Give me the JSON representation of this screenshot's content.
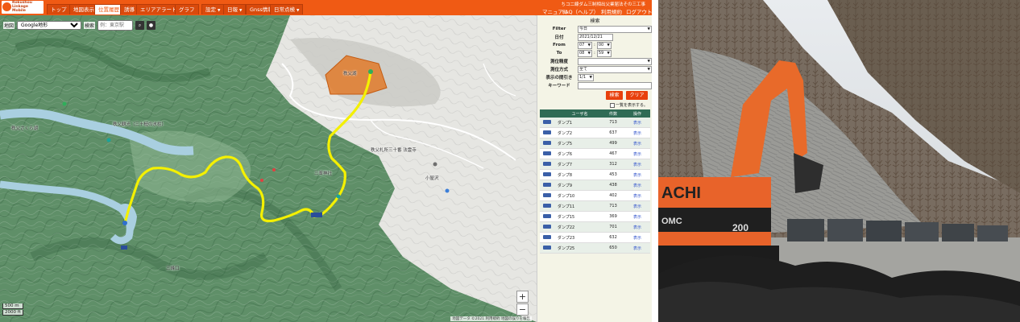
{
  "header": {
    "logo_lines": [
      "Rokushou",
      "Linkage",
      "Mobile"
    ],
    "site_title": "ちコ二線ダム三制相出父業届法その三工事",
    "nav": [
      {
        "label": "トップ",
        "active": false,
        "dropdown": false
      },
      {
        "label": "地図表示",
        "active": false,
        "dropdown": false
      },
      {
        "label": "位置履歴",
        "active": true,
        "dropdown": false
      },
      {
        "label": "誘導",
        "active": false,
        "dropdown": false
      },
      {
        "label": "エリアアラート",
        "active": false,
        "dropdown": false
      },
      {
        "label": "グラフ",
        "active": false,
        "dropdown": false
      },
      {
        "label": "設定",
        "active": false,
        "dropdown": true
      },
      {
        "label": "日報",
        "active": false,
        "dropdown": true
      },
      {
        "label": "Gnss情報",
        "active": false,
        "dropdown": false
      },
      {
        "label": "日常点検",
        "active": false,
        "dropdown": true
      }
    ],
    "right_links": [
      "マニュアル",
      "FAQ（ヘルプ）",
      "利用規約",
      "ログアウト"
    ]
  },
  "map": {
    "map_type_label": "地図",
    "map_type_value": "Google地形",
    "search_label": "検索",
    "search_placeholder": "例：東京駅",
    "zoom_in": "+",
    "zoom_out": "−",
    "scale": [
      "500 m",
      "2000 ft"
    ],
    "attribution": "地図データ ©2021  利用規約  地図の誤りを報告",
    "place_labels": [
      {
        "text": "秩父湖"
      },
      {
        "text": "秩父さくら湖"
      },
      {
        "text": "秩父観光（三十槌の氷柱）"
      },
      {
        "text": "秩父札所三十番 法雲寺"
      },
      {
        "text": "小屋沢"
      },
      {
        "text": "三峯神社"
      },
      {
        "text": "三峰口"
      }
    ]
  },
  "panel": {
    "title": "検索",
    "filter_label": "Filter",
    "filter_value": "今日",
    "date_label": "日付",
    "date_value": "2021/12/21",
    "from_label": "From",
    "from_hour": "07",
    "from_min": "00",
    "to_label": "To",
    "to_hour": "08",
    "to_min": "59",
    "accuracy_label": "測位精度",
    "accuracy_value": "",
    "method_label": "測位方式",
    "method_value": "全て",
    "thin_label": "表示の間引き",
    "thin_value": "1/1",
    "keyword_label": "キーワード",
    "keyword_value": "",
    "search_button": "検索",
    "clear_button": "クリア",
    "show_all_label": "一覧を表示する。",
    "table_headers": [
      "",
      "ユーザ名",
      "件数",
      "操作"
    ],
    "rows": [
      {
        "name": "ダンプ1",
        "count": "713",
        "action": "表示"
      },
      {
        "name": "ダンプ2",
        "count": "637",
        "action": "表示"
      },
      {
        "name": "ダンプ5",
        "count": "499",
        "action": "表示"
      },
      {
        "name": "ダンプ6",
        "count": "467",
        "action": "表示"
      },
      {
        "name": "ダンプ7",
        "count": "312",
        "action": "表示"
      },
      {
        "name": "ダンプ8",
        "count": "453",
        "action": "表示"
      },
      {
        "name": "ダンプ9",
        "count": "438",
        "action": "表示"
      },
      {
        "name": "ダンプ10",
        "count": "402",
        "action": "表示"
      },
      {
        "name": "ダンプ11",
        "count": "713",
        "action": "表示"
      },
      {
        "name": "ダンプ15",
        "count": "369",
        "action": "表示"
      },
      {
        "name": "ダンプ22",
        "count": "701",
        "action": "表示"
      },
      {
        "name": "ダンプ23",
        "count": "632",
        "action": "表示"
      },
      {
        "name": "ダンプ25",
        "count": "650",
        "action": "表示"
      }
    ]
  },
  "photo": {
    "excavator_brand": "ACHI",
    "excavator_model": "200",
    "excavator_badge": "OMC"
  },
  "colors": {
    "brand": "#f05a14",
    "track": "#f4f000",
    "table_header": "#2f6b55"
  }
}
